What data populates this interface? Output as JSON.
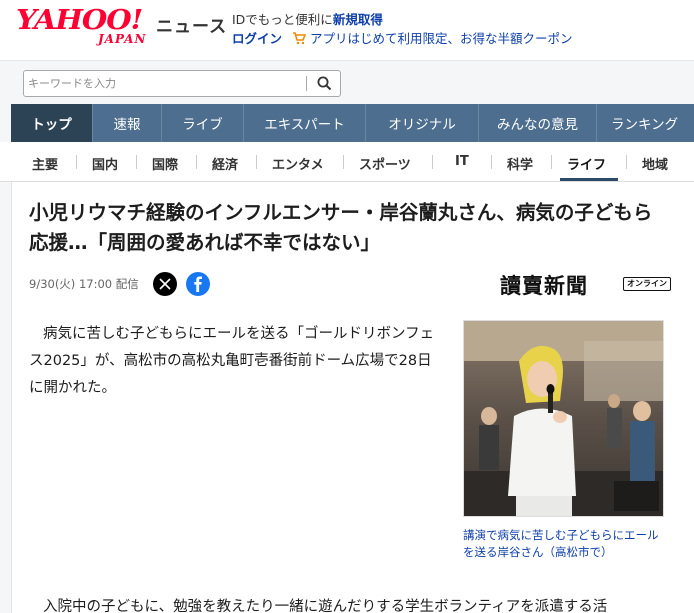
{
  "header": {
    "logo_text": "YAHOO!",
    "logo_sub": "JAPAN",
    "section": "ニュース",
    "promo_prefix": "IDでもっと便利に",
    "promo_link": "新規取得",
    "login": "ログイン",
    "app_promo": "アプリはじめて利用限定、お得な半額クーポン"
  },
  "search": {
    "placeholder": "キーワードを入力"
  },
  "main_nav": [
    "トップ",
    "速報",
    "ライブ",
    "エキスパート",
    "オリジナル",
    "みんなの意見",
    "ランキング"
  ],
  "sub_nav": [
    "主要",
    "国内",
    "国際",
    "経済",
    "エンタメ",
    "スポーツ",
    "IT",
    "科学",
    "ライフ",
    "地域"
  ],
  "article": {
    "headline": "小児リウマチ経験のインフルエンサー・岸谷蘭丸さん、病気の子どもら応援…「周囲の愛あれば不幸ではない」",
    "date": "9/30(火) 17:00",
    "delivered": "配信",
    "publisher": "讀賣新聞",
    "publisher_badge": "オンライン",
    "paragraph1": "病気に苦しむ子どもらにエールを送る「ゴールドリボンフェス2025」が、高松市の高松丸亀町壱番街前ドーム広場で28日に開かれた。",
    "paragraph2": "入院中の子どもに、勉強を教えたり一緒に遊んだりする学生ボランティアを派遣する活",
    "caption": "講演で病気に苦しむ子どもらにエールを送る岸谷さん（高松市で）"
  },
  "colors": {
    "brand_red": "#ff0033",
    "nav_bg": "#4d6e8e",
    "nav_active": "#2c4255",
    "link_blue": "#0e3fa8"
  }
}
